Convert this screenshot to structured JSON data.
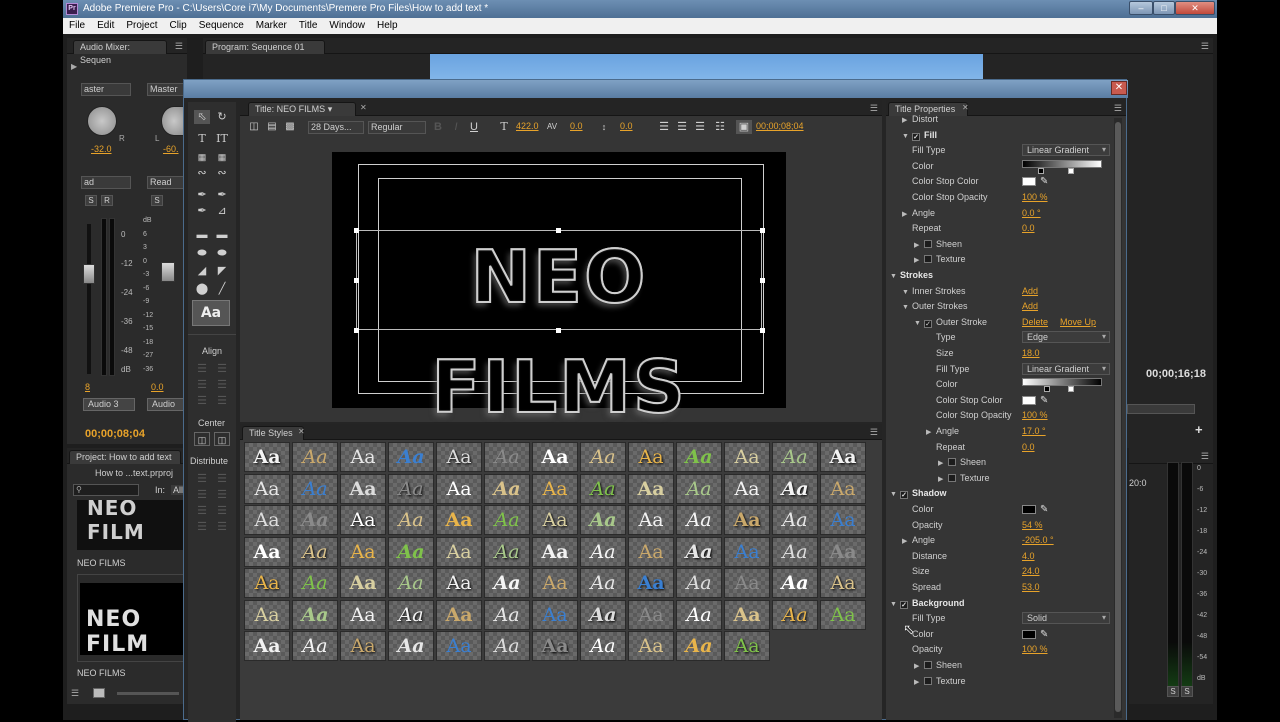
{
  "window": {
    "title": "Adobe Premiere Pro - C:\\Users\\Core i7\\My Documents\\Premere Pro Files\\How to add text *",
    "icon": "Pr"
  },
  "menu": [
    "File",
    "Edit",
    "Project",
    "Clip",
    "Sequence",
    "Marker",
    "Title",
    "Window",
    "Help"
  ],
  "audio_mixer": {
    "tab": "Audio Mixer: Sequen",
    "left_channel": "aster",
    "right_channel": "Master",
    "left_value": "-32.0",
    "right_value": "-60.",
    "mode_left": "ad",
    "mode_right": "Read",
    "scale": [
      "0",
      "-12",
      "-24",
      "-36",
      "-48",
      "dB"
    ],
    "scale2": [
      "dB",
      "6",
      "3",
      "0",
      "-3",
      "-6",
      "-9",
      "-12",
      "-15",
      "-18",
      "-27",
      "-36"
    ],
    "track_left_value": "8",
    "track_right_value": "0.0",
    "track_name": "Audio 3",
    "track_name2": "Audio",
    "timecode": "00;00;08;04",
    "s_label": "S",
    "r_label": "R",
    "l_label": "L"
  },
  "program_monitor": {
    "tab": "Program: Sequence 01",
    "timecode": "00;00;16;18"
  },
  "project": {
    "tab": "Project: How to add text",
    "file": "How to ...text.prproj",
    "in_label": "In:",
    "in_value": "All",
    "clip1": "NEO FILMS",
    "clip2": "NEO FILMS",
    "thumb_text": "NEO FILM"
  },
  "titler": {
    "tab": "Title: NEO FILMS",
    "font": "28 Days...",
    "style": "Regular",
    "size": "422.0",
    "kerning": "0.0",
    "leading": "0.0",
    "timecode": "00;00;08;04",
    "canvas_text": "NEO FILMS",
    "align_label": "Align",
    "center_label": "Center",
    "distribute_label": "Distribute",
    "styles_tab": "Title Styles",
    "style_sample": "Aa"
  },
  "properties": {
    "tab": "Title Properties",
    "rows": [
      {
        "indent": 1,
        "tri": "▶",
        "check": false,
        "label": "Distort",
        "value": "",
        "kind": "plain"
      },
      {
        "indent": 1,
        "tri": "▼",
        "check": true,
        "label": "Fill",
        "value": "",
        "kind": "bold"
      },
      {
        "indent": 1,
        "tri": "",
        "check": false,
        "label": "Fill Type",
        "value": "Linear Gradient",
        "kind": "dd"
      },
      {
        "indent": 1,
        "tri": "",
        "check": false,
        "label": "Color",
        "value": "",
        "kind": "grad"
      },
      {
        "indent": 1,
        "tri": "",
        "check": false,
        "label": "Color Stop Color",
        "value": "",
        "kind": "swatch-white"
      },
      {
        "indent": 1,
        "tri": "",
        "check": false,
        "label": "Color Stop Opacity",
        "value": "100 %",
        "kind": "val"
      },
      {
        "indent": 1,
        "tri": "▶",
        "check": false,
        "label": "Angle",
        "value": "0.0 °",
        "kind": "val"
      },
      {
        "indent": 1,
        "tri": "",
        "check": false,
        "label": "Repeat",
        "value": "0.0",
        "kind": "val"
      },
      {
        "indent": 2,
        "tri": "▶",
        "check": false,
        "label": "Sheen",
        "value": "",
        "kind": "box"
      },
      {
        "indent": 2,
        "tri": "▶",
        "check": false,
        "label": "Texture",
        "value": "",
        "kind": "box"
      },
      {
        "indent": 0,
        "tri": "▼",
        "check": false,
        "label": "Strokes",
        "value": "",
        "kind": "bold"
      },
      {
        "indent": 1,
        "tri": "▼",
        "check": false,
        "label": "Inner Strokes",
        "value": "Add",
        "kind": "link"
      },
      {
        "indent": 1,
        "tri": "▼",
        "check": false,
        "label": "Outer Strokes",
        "value": "Add",
        "kind": "link"
      },
      {
        "indent": 2,
        "tri": "▼",
        "check": true,
        "label": "Outer Stroke",
        "value": "Delete",
        "value2": "Move Up",
        "kind": "link2"
      },
      {
        "indent": 3,
        "tri": "",
        "check": false,
        "label": "Type",
        "value": "Edge",
        "kind": "dd"
      },
      {
        "indent": 3,
        "tri": "",
        "check": false,
        "label": "Size",
        "value": "18.0",
        "kind": "val"
      },
      {
        "indent": 3,
        "tri": "",
        "check": false,
        "label": "Fill Type",
        "value": "Linear Gradient",
        "kind": "dd"
      },
      {
        "indent": 3,
        "tri": "",
        "check": false,
        "label": "Color",
        "value": "",
        "kind": "grad2"
      },
      {
        "indent": 3,
        "tri": "",
        "check": false,
        "label": "Color Stop Color",
        "value": "",
        "kind": "swatch-white"
      },
      {
        "indent": 3,
        "tri": "",
        "check": false,
        "label": "Color Stop Opacity",
        "value": "100 %",
        "kind": "val"
      },
      {
        "indent": 3,
        "tri": "▶",
        "check": false,
        "label": "Angle",
        "value": "17.0 °",
        "kind": "val"
      },
      {
        "indent": 3,
        "tri": "",
        "check": false,
        "label": "Repeat",
        "value": "0.0",
        "kind": "val"
      },
      {
        "indent": 4,
        "tri": "▶",
        "check": false,
        "label": "Sheen",
        "value": "",
        "kind": "box"
      },
      {
        "indent": 4,
        "tri": "▶",
        "check": false,
        "label": "Texture",
        "value": "",
        "kind": "box"
      },
      {
        "indent": 0,
        "tri": "▼",
        "check": true,
        "label": "Shadow",
        "value": "",
        "kind": "bold"
      },
      {
        "indent": 1,
        "tri": "",
        "check": false,
        "label": "Color",
        "value": "",
        "kind": "swatch-black"
      },
      {
        "indent": 1,
        "tri": "",
        "check": false,
        "label": "Opacity",
        "value": "54 %",
        "kind": "val"
      },
      {
        "indent": 1,
        "tri": "▶",
        "check": false,
        "label": "Angle",
        "value": "-205.0 °",
        "kind": "val"
      },
      {
        "indent": 1,
        "tri": "",
        "check": false,
        "label": "Distance",
        "value": "4.0",
        "kind": "val"
      },
      {
        "indent": 1,
        "tri": "",
        "check": false,
        "label": "Size",
        "value": "24.0",
        "kind": "val"
      },
      {
        "indent": 1,
        "tri": "",
        "check": false,
        "label": "Spread",
        "value": "53.0",
        "kind": "val"
      },
      {
        "indent": 0,
        "tri": "▼",
        "check": true,
        "label": "Background",
        "value": "",
        "kind": "bold"
      },
      {
        "indent": 1,
        "tri": "",
        "check": false,
        "label": "Fill Type",
        "value": "Solid",
        "kind": "dd"
      },
      {
        "indent": 1,
        "tri": "",
        "check": false,
        "label": "Color",
        "value": "",
        "kind": "swatch-black"
      },
      {
        "indent": 1,
        "tri": "",
        "check": false,
        "label": "Opacity",
        "value": "100 %",
        "kind": "val"
      },
      {
        "indent": 2,
        "tri": "▶",
        "check": false,
        "label": "Sheen",
        "value": "",
        "kind": "box"
      },
      {
        "indent": 2,
        "tri": "▶",
        "check": false,
        "label": "Texture",
        "value": "",
        "kind": "box"
      }
    ]
  },
  "right_meter": {
    "scale": [
      "0",
      "-6",
      "-12",
      "-18",
      "-24",
      "-30",
      "-36",
      "-42",
      "-48",
      "-54",
      "dB"
    ],
    "partial": "20:0",
    "s_label": "S"
  }
}
